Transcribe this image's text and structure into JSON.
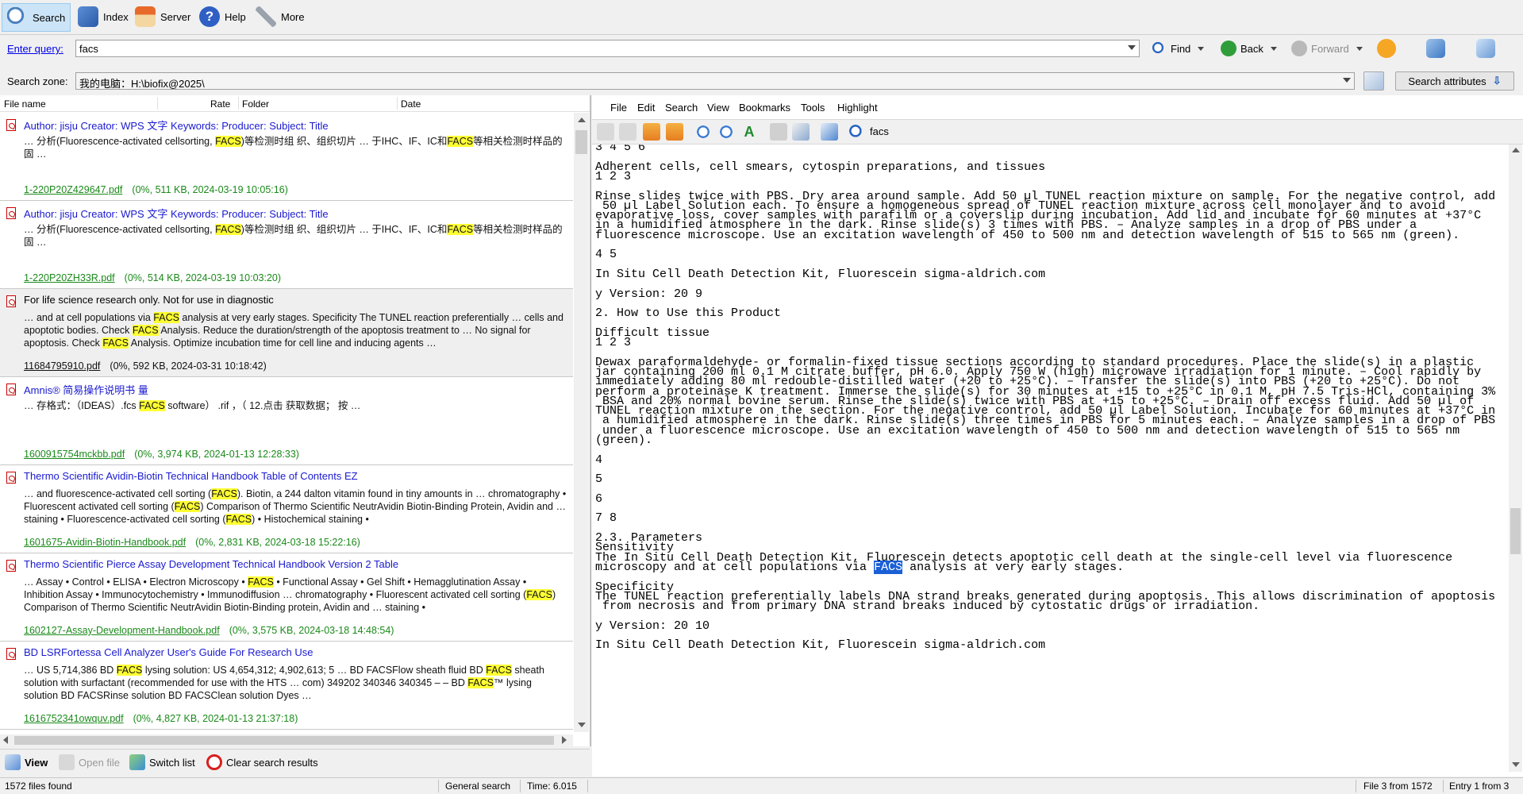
{
  "toolbar": {
    "search": "Search",
    "index": "Index",
    "server": "Server",
    "help": "Help",
    "more": "More"
  },
  "query": {
    "label": "Enter query:",
    "value": "facs",
    "find": "Find",
    "back": "Back",
    "forward": "Forward"
  },
  "zone": {
    "label": "Search zone:",
    "value": "我的电脑：H:\\biofix@2025\\",
    "attributes_button": "Search attributes"
  },
  "columns": {
    "file_name": "File name",
    "rate": "Rate",
    "folder": "Folder",
    "date": "Date"
  },
  "results": [
    {
      "title": "Author: jisju Creator: WPS 文字 Keywords: Producer: Subject: Title",
      "snippet": [
        {
          "t": " …  分析(Fluorescence-activated cellsorting, "
        },
        {
          "t": "FACS",
          "h": true
        },
        {
          "t": ")等检测时组 织、组织切片  …  于IHC、IF、IC和"
        },
        {
          "t": "FACS",
          "h": true
        },
        {
          "t": "等相关检测时样品的固  …"
        }
      ],
      "file": "1-220P20Z429647.pdf",
      "meta": "(0%, 511 KB, 2024-03-19 10:05:16)"
    },
    {
      "title": "Author: jisju Creator: WPS 文字 Keywords: Producer: Subject: Title",
      "snippet": [
        {
          "t": " …  分析(Fluorescence-activated cellsorting, "
        },
        {
          "t": "FACS",
          "h": true
        },
        {
          "t": ")等检测时组 织、组织切片  …  于IHC、IF、IC和"
        },
        {
          "t": "FACS",
          "h": true
        },
        {
          "t": "等相关检测时样品的固  …"
        }
      ],
      "file": "1-220P20ZH33R.pdf",
      "meta": "(0%, 514 KB, 2024-03-19 10:03:20)"
    },
    {
      "title": "For life science research only. Not for use in diagnostic",
      "snippet": [
        {
          "t": " …  and at cell populations via "
        },
        {
          "t": "FACS",
          "h": true
        },
        {
          "t": " analysis at very early stages. Specificity The TUNEL reaction preferentially  …  cells and apoptotic bodies. Check "
        },
        {
          "t": "FACS",
          "h": true
        },
        {
          "t": " Analysis. Reduce the duration/strength of the apoptosis treatment to  …  No signal for apoptosis. Check "
        },
        {
          "t": "FACS",
          "h": true
        },
        {
          "t": " Analysis. Optimize incubation time for cell line and inducing agents  …"
        }
      ],
      "file": "11684795910.pdf",
      "meta": "(0%, 592 KB, 2024-03-31 10:18:42)"
    },
    {
      "title": "Amnis® 简易操作说明书 量",
      "snippet": [
        {
          "t": " …  存格式：（IDEAS）.fcs "
        },
        {
          "t": "FACS",
          "h": true
        },
        {
          "t": " software） .rif ，（ 12.点击 获取数据；  按  …"
        }
      ],
      "file": "1600915754mckbb.pdf",
      "meta": "(0%, 3,974 KB, 2024-01-13 12:28:33)"
    },
    {
      "title": "Thermo Scientific Avidin-Biotin Technical Handbook Table of Contents EZ",
      "snippet": [
        {
          "t": " …  and fluorescence-activated cell sorting ("
        },
        {
          "t": "FACS",
          "h": true
        },
        {
          "t": "). Biotin, a 244 dalton vitamin found in tiny amounts in  …  chromatography • Fluorescent activated cell sorting ("
        },
        {
          "t": "FACS",
          "h": true
        },
        {
          "t": ") Comparison of Thermo Scientific NeutrAvidin Biotin-Binding Protein, Avidin and  …  staining • Fluorescence-activated cell sorting ("
        },
        {
          "t": "FACS",
          "h": true
        },
        {
          "t": ") • Histochemical staining •"
        }
      ],
      "file": "1601675-Avidin-Biotin-Handbook.pdf",
      "meta": "(0%, 2,831 KB, 2024-03-18 15:22:16)"
    },
    {
      "title": "Thermo Scientific Pierce Assay Development Technical Handbook Version 2 Table",
      "snippet": [
        {
          "t": " …  Assay • Control • ELISA • Electron Microscopy • "
        },
        {
          "t": "FACS",
          "h": true
        },
        {
          "t": " • Functional Assay • Gel Shift • Hemagglutination Assay • Inhibition Assay • Immunocytochemistry • Immunodiffusion  …  chromatography • Fluorescent activated cell sorting ("
        },
        {
          "t": "FACS",
          "h": true
        },
        {
          "t": ") Comparison of Thermo Scientific NeutrAvidin Biotin-Binding protein, Avidin and  …  staining •"
        }
      ],
      "file": "1602127-Assay-Development-Handbook.pdf",
      "meta": "(0%, 3,575 KB, 2024-03-18 14:48:54)"
    },
    {
      "title": "BD LSRFortessa Cell Analyzer User's Guide For Research Use",
      "snippet": [
        {
          "t": " …  US 5,714,386 BD "
        },
        {
          "t": "FACS",
          "h": true
        },
        {
          "t": " lysing solution: US 4,654,312; 4,902,613; 5  …  BD FACSFlow sheath fluid BD "
        },
        {
          "t": "FACS",
          "h": true
        },
        {
          "t": " sheath solution with surfactant (recommended for use with the HTS  …  com) 349202 340346 340345 – – BD "
        },
        {
          "t": "FACS",
          "h": true
        },
        {
          "t": "™ lysing solution BD FACSRinse solution BD FACSClean solution Dyes  …"
        }
      ],
      "file": "1616752341owquv.pdf",
      "meta": "(0%, 4,827 KB, 2024-01-13 21:37:18)"
    }
  ],
  "left_bottom": {
    "view": "View",
    "open_file": "Open file",
    "switch_list": "Switch list",
    "clear": "Clear search results"
  },
  "status": {
    "files_found": "1572 files found",
    "mode": "General search",
    "time": "Time: 6.015",
    "file_pos": "File 3 from 1572",
    "entry_pos": "Entry 1 from 3"
  },
  "viewer": {
    "menu": [
      "File",
      "Edit",
      "Search",
      "View",
      "Bookmarks",
      "Tools",
      "Highlight"
    ],
    "search_term": "facs",
    "lines": [
      "3 4 5 6",
      "",
      "Adherent cells, cell smears, cytospin preparations, and tissues",
      "1 2 3",
      "",
      "Rinse slides twice with PBS. Dry area around sample. Add 50 µl TUNEL reaction mixture on sample. For the negative control, add",
      " 50 µl Label Solution each. To ensure a homogeneous spread of TUNEL reaction mixture across cell monolayer and to avoid",
      "evaporative loss, cover samples with parafilm or a coverslip during incubation. Add lid and incubate for 60 minutes at +37°C",
      "in a humidified atmosphere in the dark. Rinse slide(s) 3 times with PBS. – Analyze samples in a drop of PBS under a",
      "fluorescence microscope. Use an excitation wavelength of 450 to 500 nm and detection wavelength of 515 to 565 nm (green).",
      "",
      "4 5",
      "",
      "In Situ Cell Death Detection Kit, Fluorescein sigma-aldrich.com",
      "",
      "y Version: 20 9",
      "",
      "2. How to Use this Product",
      "",
      "Difficult tissue",
      "1 2 3",
      "",
      "Dewax paraformaldehyde- or formalin-fixed tissue sections according to standard procedures. Place the slide(s) in a plastic",
      "jar containing 200 ml 0.1 M citrate buffer, pH 6.0. Apply 750 W (high) microwave irradiation for 1 minute. – Cool rapidly by",
      "immediately adding 80 ml redouble-distilled water (+20 to +25°C). – Transfer the slide(s) into PBS (+20 to +25°C). Do not",
      "perform a proteinase K treatment. Immerse the slide(s) for 30 minutes at +15 to +25°C in 0.1 M, pH 7.5 Tris-HCl, containing 3%",
      " BSA and 20% normal bovine serum. Rinse the slide(s) twice with PBS at +15 to +25°C. – Drain off excess fluid. Add 50 µl of",
      "TUNEL reaction mixture on the section. For the negative control, add 50 µl Label Solution. Incubate for 60 minutes at +37°C in",
      " a humidified atmosphere in the dark. Rinse slide(s) three times in PBS for 5 minutes each. – Analyze samples in a drop of PBS",
      " under a fluorescence microscope. Use an excitation wavelength of 450 to 500 nm and detection wavelength of 515 to 565 nm",
      "(green).",
      "",
      "4",
      "",
      "5",
      "",
      "6",
      "",
      "7 8",
      "",
      "2.3. Parameters",
      "Sensitivity",
      "The In Situ Cell Death Detection Kit, Fluorescein detects apoptotic cell death at the single-cell level via fluorescence",
      "microscopy and at cell populations via FACS analysis at very early stages.",
      "",
      "Specificity",
      "The TUNEL reaction preferentially labels DNA strand breaks generated during apoptosis. This allows discrimination of apoptosis",
      " from necrosis and from primary DNA strand breaks induced by cytostatic drugs or irradiation.",
      "",
      "y Version: 20 10",
      "",
      "In Situ Cell Death Detection Kit, Fluorescein sigma-aldrich.com"
    ],
    "highlight_word": "FACS"
  },
  "colors": {
    "highlight": "#ffff33",
    "selection": "#1a5fd6",
    "link": "#1a1ad0",
    "file_link": "#1b8a1b"
  }
}
